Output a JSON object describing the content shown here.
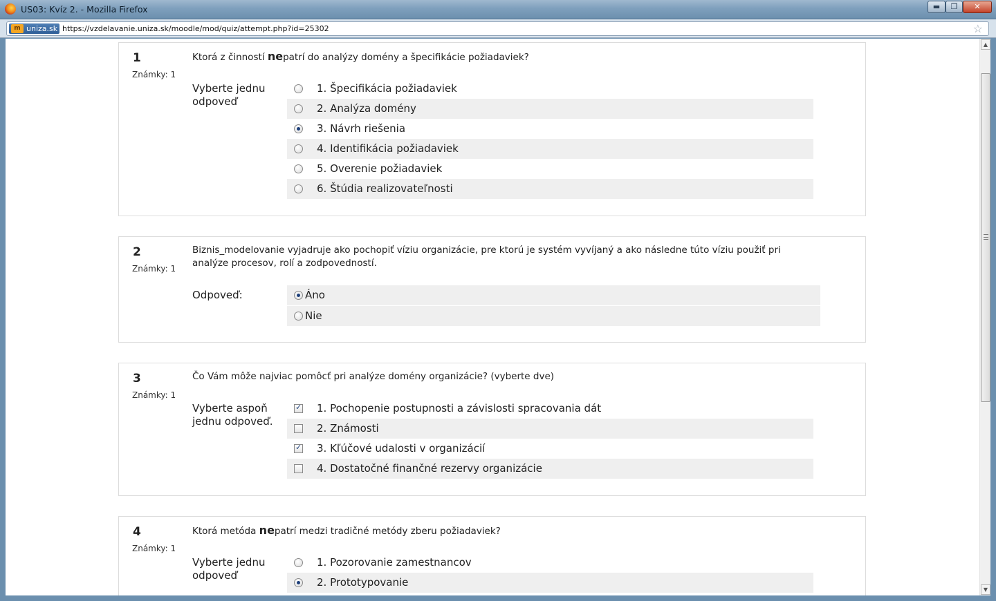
{
  "window": {
    "title": "US03: Kvíz 2. - Mozilla Firefox",
    "minimize": "▬",
    "maximize": "❐",
    "close": "✕"
  },
  "addressbar": {
    "site_identity": "uniza.sk",
    "site_icon_text": "m",
    "url": "https://vzdelavanie.uniza.sk/moodle/mod/quiz/attempt.php?id=25302",
    "bookmark_icon": "☆"
  },
  "scrollbar": {
    "up": "▲",
    "down": "▼"
  },
  "questions": [
    {
      "number": "1",
      "grade": "Známky: 1",
      "text_before": "Ktorá z činností ",
      "text_bold": "ne",
      "text_after": "patrí do analýzy domény a špecifikácie požiadaviek?",
      "prompt": "Vyberte jednu odpoveď",
      "type": "radio",
      "answers": [
        {
          "label": "1. Špecifikácia požiadaviek",
          "selected": false
        },
        {
          "label": "2. Analýza domény",
          "selected": false
        },
        {
          "label": "3. Návrh riešenia",
          "selected": true
        },
        {
          "label": "4. Identifikácia požiadaviek",
          "selected": false
        },
        {
          "label": "5. Overenie požiadaviek",
          "selected": false
        },
        {
          "label": "6. Štúdia realizovateľnosti",
          "selected": false
        }
      ]
    },
    {
      "number": "2",
      "grade": "Známky: 1",
      "text": "Biznis_modelovanie vyjadruje ako pochopiť víziu organizácie, pre ktorú je systém vyvíjaný a ako následne túto víziu použiť pri analýze procesov, rolí a zodpovedností.",
      "prompt": "Odpoveď:",
      "type": "radio",
      "answers": [
        {
          "label": "Áno",
          "selected": true
        },
        {
          "label": "Nie",
          "selected": false
        }
      ]
    },
    {
      "number": "3",
      "grade": "Známky: 1",
      "text": "Čo Vám môže najviac pomôcť pri analýze domény organizácie? (vyberte dve)",
      "prompt": "Vyberte aspoň jednu odpoveď.",
      "type": "checkbox",
      "answers": [
        {
          "label": "1. Pochopenie postupnosti a závislosti spracovania dát",
          "selected": true
        },
        {
          "label": "2. Známosti",
          "selected": false
        },
        {
          "label": "3. Kľúčové udalosti v organizácií",
          "selected": true
        },
        {
          "label": "4. Dostatočné finančné rezervy organizácie",
          "selected": false
        }
      ]
    },
    {
      "number": "4",
      "grade": "Známky: 1",
      "text_before": "Ktorá metóda ",
      "text_bold": "ne",
      "text_after": "patrí medzi tradičné metódy zberu požiadaviek?",
      "prompt": "Vyberte jednu odpoveď",
      "type": "radio",
      "answers": [
        {
          "label": "1. Pozorovanie zamestnancov",
          "selected": false
        },
        {
          "label": "2. Prototypovanie",
          "selected": true
        }
      ]
    }
  ]
}
